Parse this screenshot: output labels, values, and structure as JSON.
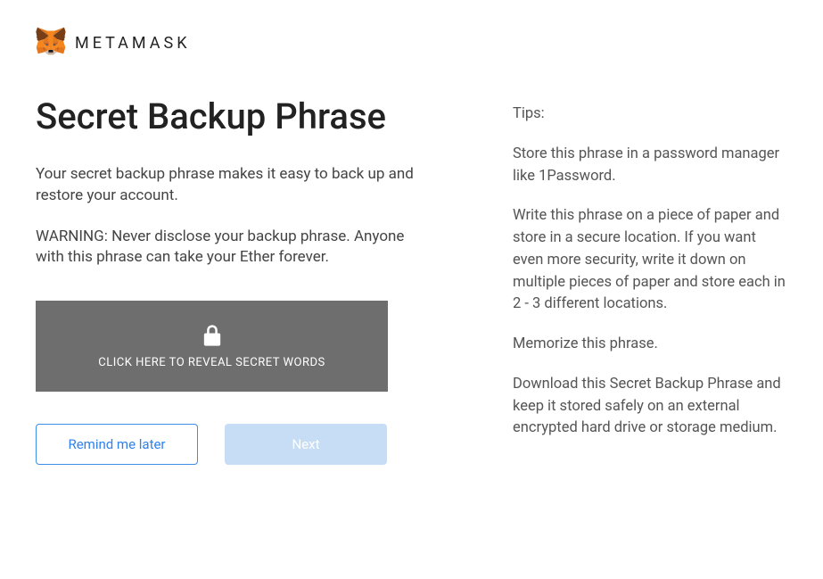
{
  "header": {
    "brand": "METAMASK"
  },
  "main": {
    "title": "Secret Backup Phrase",
    "description": "Your secret backup phrase makes it easy to back up and restore your account.",
    "warning": "WARNING: Never disclose your backup phrase. Anyone with this phrase can take your Ether forever.",
    "reveal_label": "CLICK HERE TO REVEAL SECRET WORDS"
  },
  "buttons": {
    "remind_later": "Remind me later",
    "next": "Next"
  },
  "tips": {
    "heading": "Tips:",
    "tip1": "Store this phrase in a password manager like 1Password.",
    "tip2": "Write this phrase on a piece of paper and store in a secure location. If you want even more security, write it down on multiple pieces of paper and store each in 2 - 3 different locations.",
    "tip3": "Memorize this phrase.",
    "download_link": "Download this Secret Backup Phrase and keep it stored safely on an external encrypted hard drive or storage medium."
  }
}
